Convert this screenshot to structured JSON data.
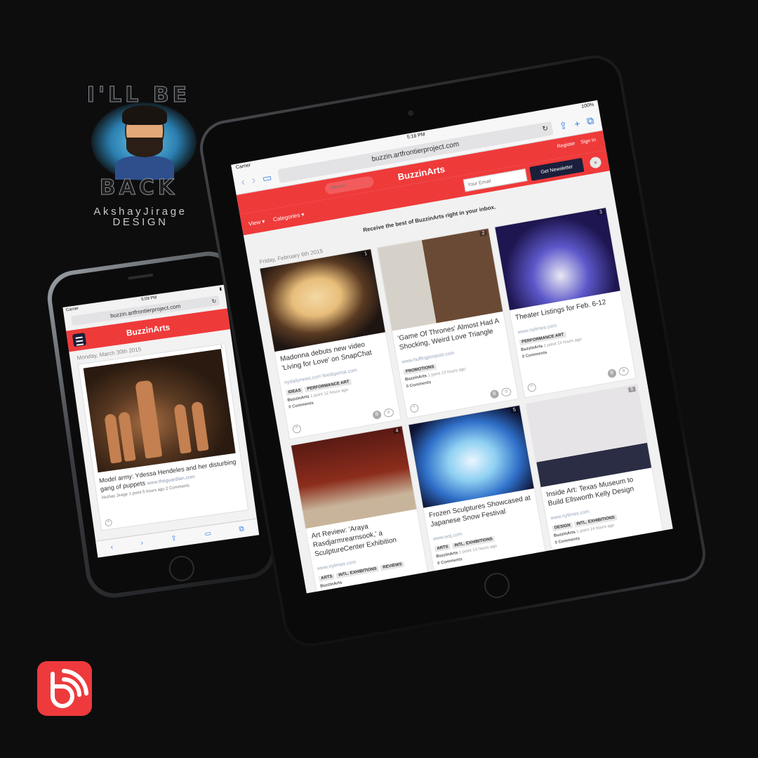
{
  "branding": {
    "top_text": "I'LL BE",
    "bottom_text": "BACK",
    "name_line1": "AkshayJirage",
    "name_line2": "DESIGN"
  },
  "phone": {
    "status": {
      "carrier": "Carrier",
      "time": "5:09 PM"
    },
    "url": "buzzin.artfrontierproject.com",
    "logo": "BuzzinArts",
    "date": "Monday, March 30th 2015",
    "card": {
      "rank": "1",
      "title": "Model army: Ydessa Hendeles and her disturbing gang of puppets",
      "source": "www.theguardian.com",
      "meta": "Akshay Jirage 1 point 5 hours ago 2 Comments"
    }
  },
  "tablet": {
    "status": {
      "carrier": "Carrier",
      "time": "5:18 PM",
      "battery": "100%"
    },
    "url": "buzzin.artfrontierproject.com",
    "header": {
      "logo": "BuzzinArts",
      "search_placeholder": "Search",
      "register": "Register",
      "sign_in": "Sign In"
    },
    "subheader": {
      "view": "View ▾",
      "categories": "Categories ▾",
      "email_placeholder": "Your Email",
      "newsletter": "Get Newsletter"
    },
    "banner": "Receive the best of BuzzinArts right in your inbox.",
    "date": "Friday, February 6th 2015",
    "cards": [
      {
        "rank": "1",
        "title": "Madonna debuts new video 'Living for Love' on SnapChat",
        "source": "nydailynews.com feedsportal.com",
        "tags": [
          "IDEAS",
          "PERFORMANCE ART"
        ],
        "author": "BuzzinArts",
        "meta": "1 point 12 hours ago",
        "comments": "0 Comments"
      },
      {
        "rank": "2",
        "title": "'Game Of Thrones' Almost Had A Shocking, Weird Love Triangle",
        "source": "www.huffingtonpost.com",
        "tags": [
          "PROMOTIONS"
        ],
        "author": "BuzzinArts",
        "meta": "1 point 13 hours ago",
        "comments": "0 Comments"
      },
      {
        "rank": "3",
        "title": "Theater Listings for Feb. 6-12",
        "source": "www.nytimes.com",
        "tags": [
          "PERFORMANCE ART"
        ],
        "author": "BuzzinArts",
        "meta": "1 point 13 hours ago",
        "comments": "0 Comments"
      },
      {
        "rank": "4",
        "title": "Art Review: 'Araya Rasdjarmrearnsook,' a SculptureCenter Exhibition",
        "source": "www.nytimes.com",
        "tags": [
          "ARTS",
          "INTL. EXHIBITIONS",
          "REVIEWS"
        ],
        "author": "BuzzinArts",
        "meta": "",
        "comments": ""
      },
      {
        "rank": "5",
        "title": "Frozen Sculptures Showcased at Japanese Snow Festival",
        "source": "www.wsj.com",
        "tags": [
          "ARTS",
          "INTL. EXHIBITIONS"
        ],
        "author": "BuzzinArts",
        "meta": "1 point 14 hours ago",
        "comments": "0 Comments"
      },
      {
        "rank": "6",
        "title": "Inside Art: Texas Museum to Build Ellsworth Kelly Design",
        "source": "www.nytimes.com",
        "tags": [
          "DESIGN",
          "INTL. EXHIBITIONS"
        ],
        "author": "BuzzinArts",
        "meta": "1 point 14 hours ago",
        "comments": "0 Comments"
      }
    ]
  },
  "colors": {
    "accent": "#ef3a3a",
    "navy": "#1b1f3b",
    "background": "#0d0d0d"
  }
}
